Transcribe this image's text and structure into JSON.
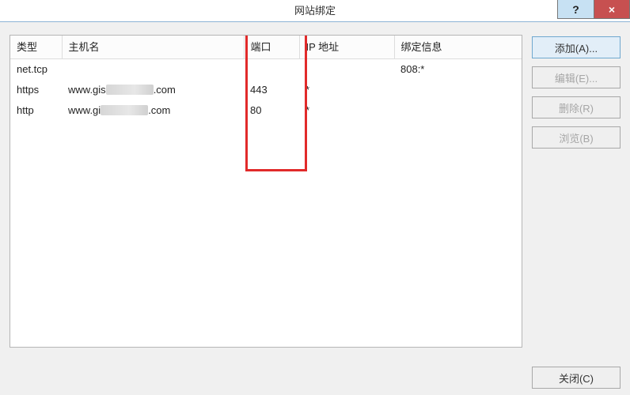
{
  "window": {
    "title": "网站绑定",
    "help_symbol": "?",
    "close_symbol": "×"
  },
  "columns": {
    "type": "类型",
    "host": "主机名",
    "port": "端口",
    "ip": "IP 地址",
    "info": "绑定信息"
  },
  "rows": [
    {
      "type": "net.tcp",
      "host_pre": "",
      "host_post": "",
      "port": "",
      "ip": "",
      "info": "808:*"
    },
    {
      "type": "https",
      "host_pre": "www.gis",
      "host_post": ".com",
      "port": "443",
      "ip": "*",
      "info": ""
    },
    {
      "type": "http",
      "host_pre": "www.gi",
      "host_post": ".com",
      "port": "80",
      "ip": "*",
      "info": ""
    }
  ],
  "buttons": {
    "add": "添加(A)...",
    "edit": "编辑(E)...",
    "delete": "删除(R)",
    "browse": "浏览(B)",
    "close": "关闭(C)"
  }
}
